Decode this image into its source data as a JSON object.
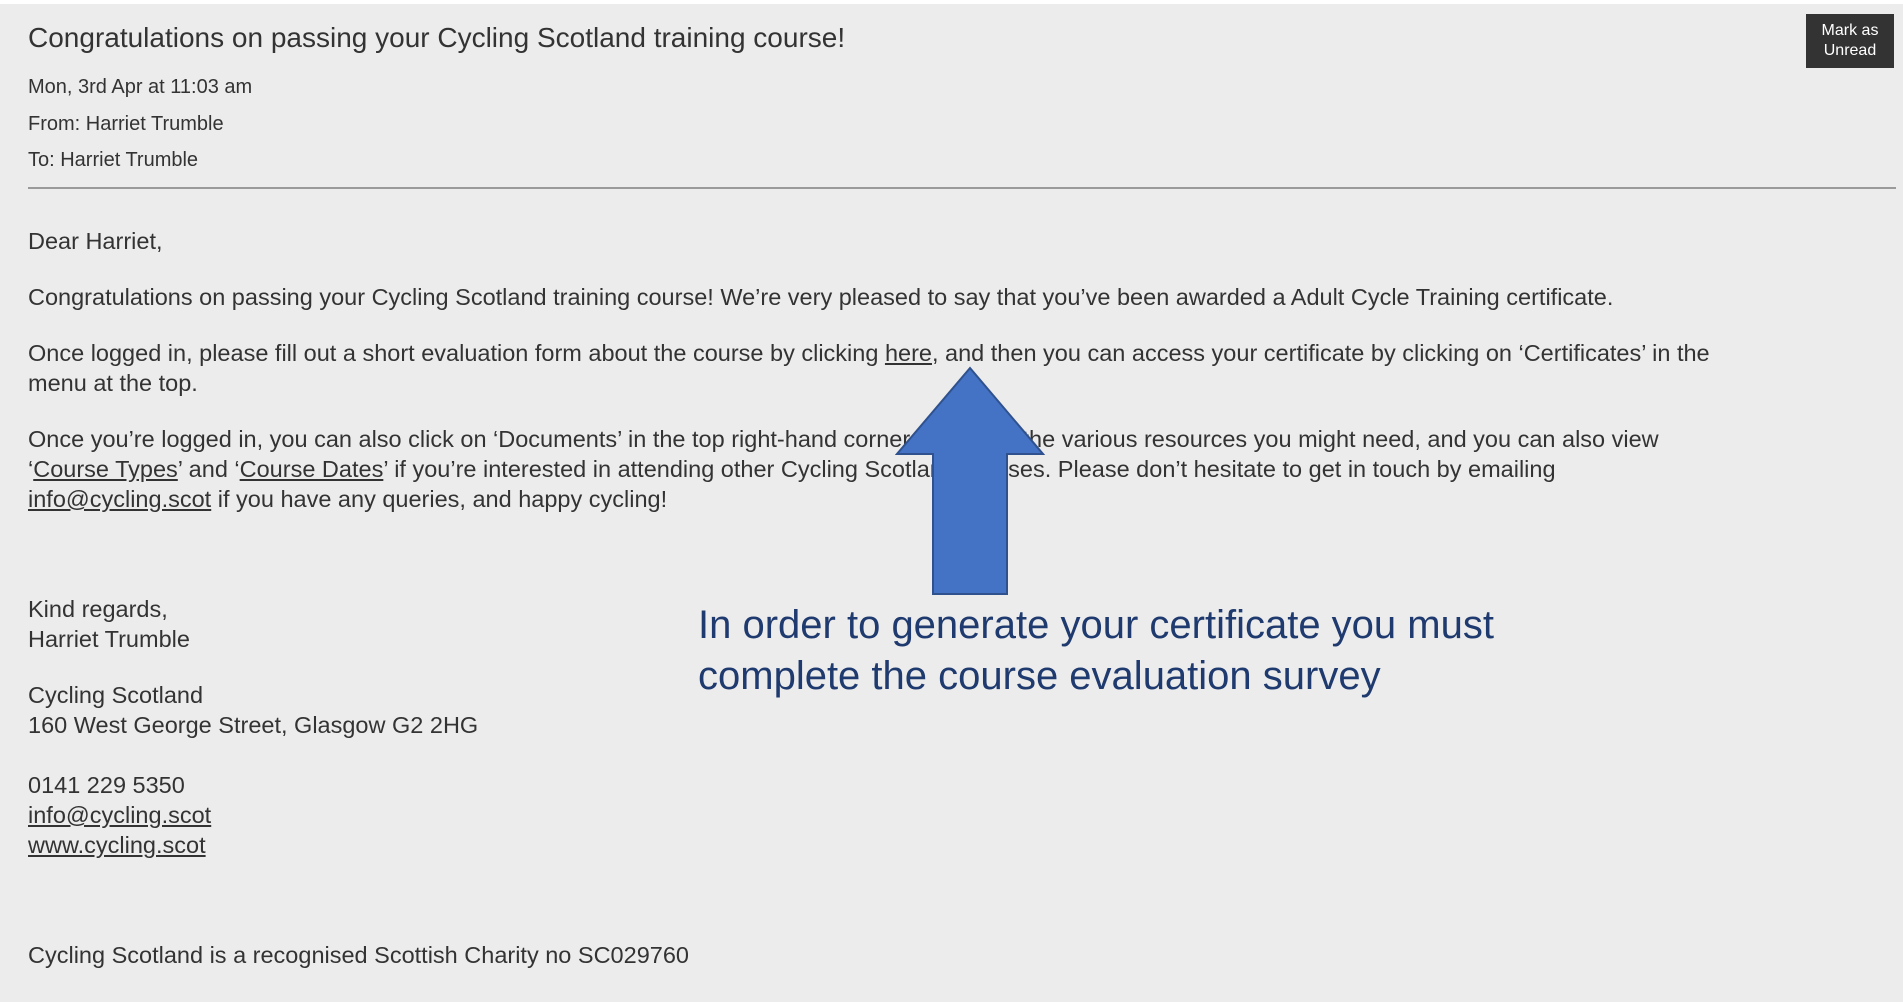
{
  "email": {
    "subject": "Congratulations on passing your Cycling Scotland training course!",
    "date": "Mon, 3rd Apr at 11:03 am",
    "from": "From: Harriet Trumble",
    "to": "To: Harriet Trumble",
    "mark_unread": {
      "line1": "Mark as",
      "line2": "Unread"
    }
  },
  "body": {
    "greeting": "Dear Harriet,",
    "para1": "Congratulations on passing your Cycling Scotland training course!  We’re very pleased to say that you’ve been awarded a Adult Cycle Training certificate.",
    "para2_a": "Once logged in, please fill out a short evaluation form about the course by clicking ",
    "para2_link": "here",
    "para2_b": ", and then you can access your certificate by clicking on ‘Certificates’ in the",
    "para2_c": "menu at the top.",
    "para3_line1": "Once you’re logged in, you can also click on ‘Documents’ in the top right-hand corner to access the various resources you might need, and you can also view",
    "para3_q1": "‘",
    "para3_link1": "Course Types",
    "para3_mid": "’ and ‘",
    "para3_link2": "Course Dates",
    "para3_rest": "’ if you’re interested in attending other Cycling Scotland courses.  Please don’t hesitate to get in touch by emailing",
    "para3_email": "info@cycling.scot",
    "para3_end": " if you have any queries, and happy cycling!",
    "regards": "Kind regards,",
    "sender": "Harriet Trumble",
    "org": "Cycling Scotland",
    "address": "160 West George Street, Glasgow G2 2HG",
    "phone": "0141 229 5350",
    "email_link": "info@cycling.scot",
    "web_link": "www.cycling.scot",
    "charity": "Cycling Scotland is a recognised Scottish Charity no SC029760"
  },
  "annotation": {
    "text": "In order to generate your certificate you must complete the course evaluation survey",
    "arrow_color": "#4472c4",
    "text_color": "#1f3a6e"
  }
}
